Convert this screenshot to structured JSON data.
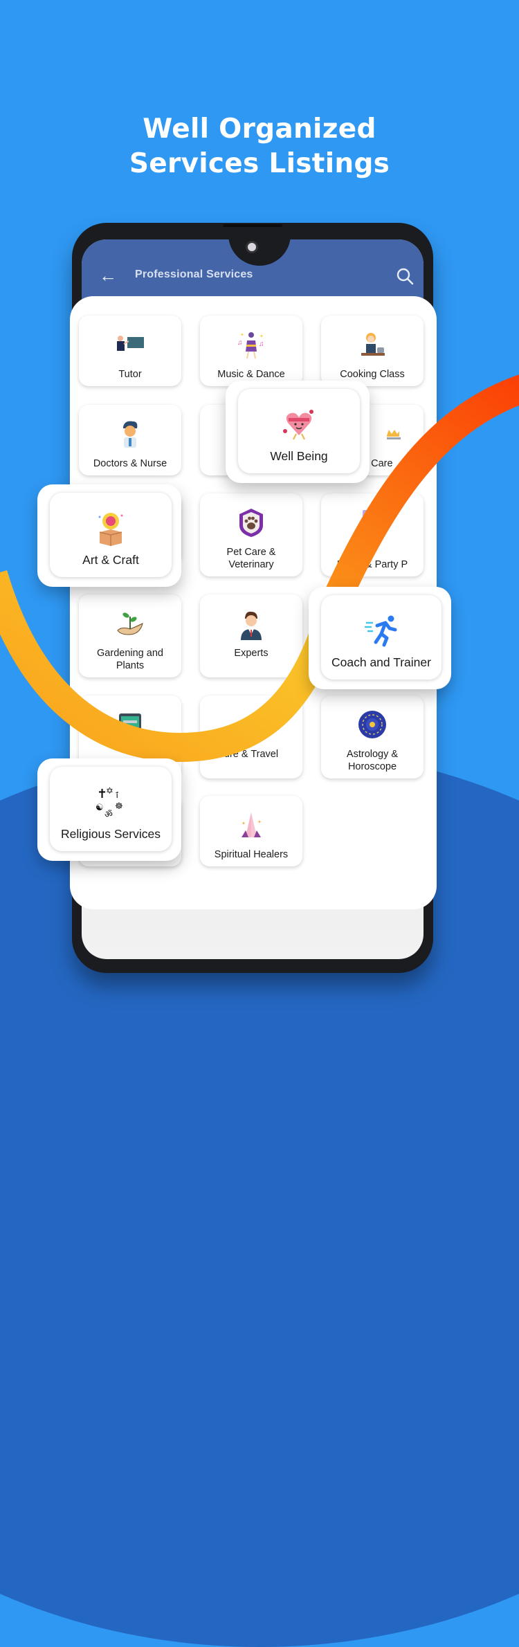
{
  "headline": {
    "line1": "Well Organized",
    "line2": "Services Listings"
  },
  "app_bar": {
    "title": "Professional Services",
    "back_icon": "arrow-left-icon",
    "search_icon": "search-icon"
  },
  "colors": {
    "background": "#2f98f3",
    "background_dark": "#2467c2",
    "app_bar": "#4466a8",
    "ribbon_start": "#fbc52a",
    "ribbon_end": "#fb4b05"
  },
  "grid_tiles": [
    {
      "label": "Tutor",
      "icon": "teacher-icon"
    },
    {
      "label": "Music & Dance",
      "icon": "dancer-icon"
    },
    {
      "label": "Cooking Class",
      "icon": "chef-icon"
    },
    {
      "label": "Doctors & Nurse",
      "icon": "doctor-icon"
    },
    {
      "label": "",
      "icon": ""
    },
    {
      "label": "d Care",
      "icon": "child-care-icon"
    },
    {
      "label": "",
      "icon": ""
    },
    {
      "label": "Pet Care & Veterinary",
      "icon": "paw-shield-icon"
    },
    {
      "label": "Event & Party P",
      "icon": "party-checklist-icon"
    },
    {
      "label": "Gardening and Plants",
      "icon": "plant-hand-icon"
    },
    {
      "label": "Experts",
      "icon": "businessman-icon"
    },
    {
      "label": "",
      "icon": ""
    },
    {
      "label": "",
      "icon": "computer-repair-icon"
    },
    {
      "label": "ure & Travel",
      "icon": "travel-icon"
    },
    {
      "label": "Astrology & Horoscope",
      "icon": "zodiac-wheel-icon"
    },
    {
      "label": "",
      "icon": ""
    },
    {
      "label": "Spiritual Healers",
      "icon": "praying-hands-icon"
    }
  ],
  "featured_tiles": [
    {
      "label": "Well Being",
      "icon": "heart-running-icon"
    },
    {
      "label": "Art & Craft",
      "icon": "idea-box-icon"
    },
    {
      "label": "Coach and Trainer",
      "icon": "runner-icon"
    },
    {
      "label": "Religious Services",
      "icon": "religious-symbols-icon"
    }
  ]
}
